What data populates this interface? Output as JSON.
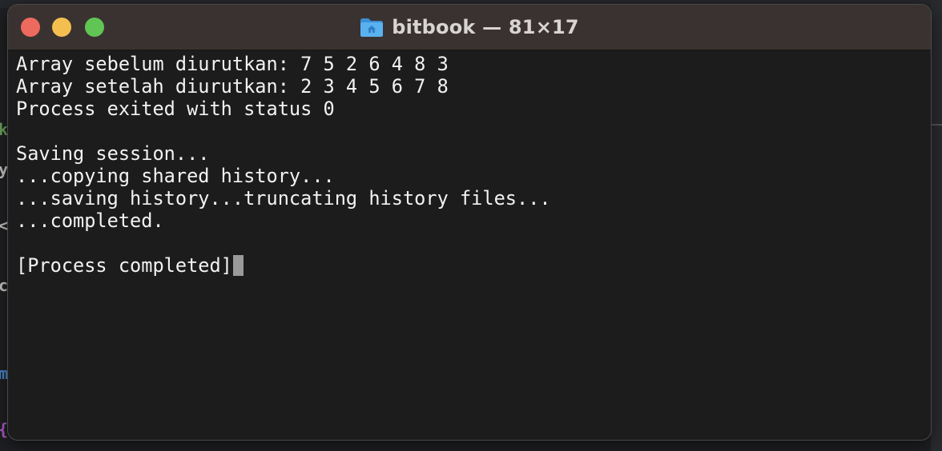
{
  "window": {
    "title": "bitbook — 81×17",
    "icon": "folder-home-icon"
  },
  "terminal": {
    "lines": [
      "Array sebelum diurutkan: 7 5 2 6 4 8 3",
      "Array setelah diurutkan: 2 3 4 5 6 7 8",
      "Process exited with status 0",
      "",
      "Saving session...",
      "...copying shared history...",
      "...saving history...truncating history files...",
      "...completed.",
      "",
      "[Process completed]"
    ],
    "cursor": "block"
  },
  "colors": {
    "titlebar": "#3a3230",
    "background": "#1c1c1c",
    "text": "#f2f2f2",
    "close": "#ed6a5e",
    "minimize": "#f5bf4f",
    "maximize": "#61c554",
    "folder": "#4aa3e8"
  }
}
